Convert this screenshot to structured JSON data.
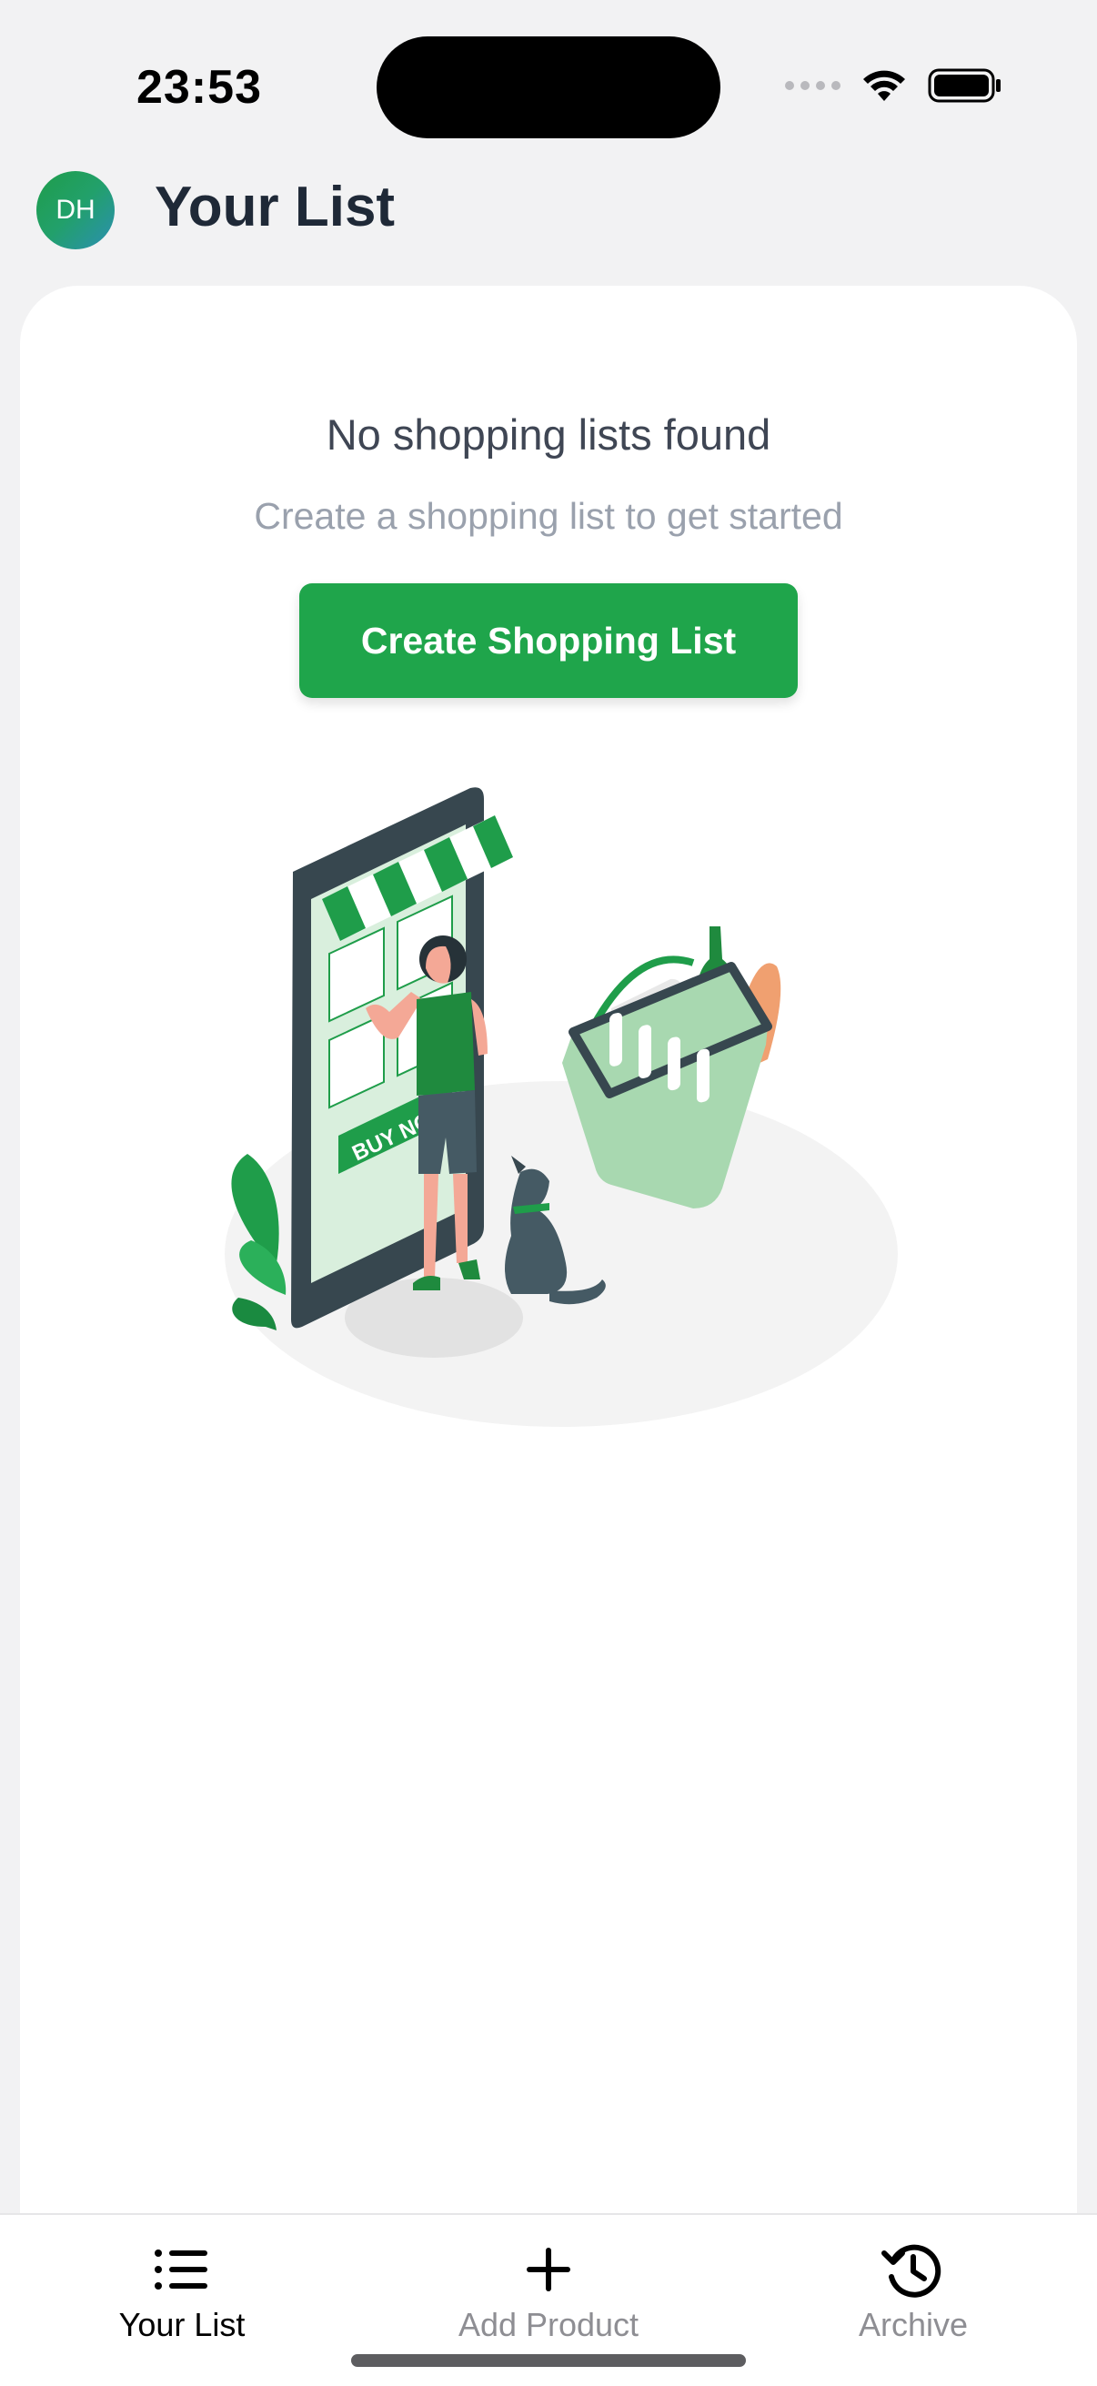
{
  "status_bar": {
    "time": "23:53"
  },
  "header": {
    "avatar_initials": "DH",
    "title": "Your List"
  },
  "empty_state": {
    "title": "No shopping lists found",
    "subtitle": "Create a shopping list to get started",
    "button_label": "Create Shopping List",
    "illustration_label": "BUY NOW"
  },
  "tab_bar": {
    "tabs": [
      {
        "label": "Your List",
        "icon": "list-icon",
        "active": true
      },
      {
        "label": "Add Product",
        "icon": "plus-icon",
        "active": false
      },
      {
        "label": "Archive",
        "icon": "history-icon",
        "active": false
      }
    ]
  },
  "colors": {
    "accent": "#1fa54b",
    "background": "#f2f2f3",
    "card": "#ffffff",
    "inactive_tab": "#8e8e93"
  }
}
